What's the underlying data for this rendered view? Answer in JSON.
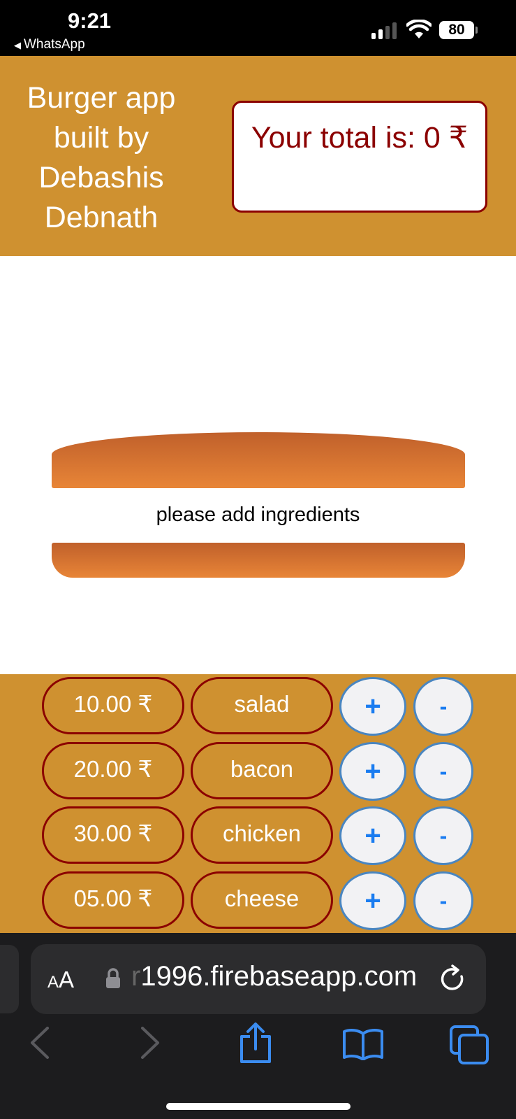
{
  "status_bar": {
    "time": "9:21",
    "back_app": "WhatsApp",
    "battery": "80"
  },
  "header": {
    "title": "Burger app built by Debashis Debnath",
    "total_label": "Your total is: 0 ₹"
  },
  "burger": {
    "empty_message": "please add ingredients"
  },
  "ingredients": [
    {
      "price": "10.00 ₹",
      "name": "salad",
      "add": "+",
      "remove": "-"
    },
    {
      "price": "20.00 ₹",
      "name": "bacon",
      "add": "+",
      "remove": "-"
    },
    {
      "price": "30.00 ₹",
      "name": "chicken",
      "add": "+",
      "remove": "-"
    },
    {
      "price": "05.00 ₹",
      "name": "cheese",
      "add": "+",
      "remove": "-"
    }
  ],
  "browser": {
    "text_size_label": "AA",
    "url_hidden_prefix": "r",
    "url": "1996.firebaseapp.com"
  },
  "colors": {
    "header_bg": "#cf9130",
    "accent_dark_red": "#8b0000",
    "bun": "#e88537",
    "button_blue": "#1a7cf0"
  },
  "icons": [
    "lock-icon",
    "reload-icon",
    "back-icon",
    "forward-icon",
    "share-icon",
    "bookmarks-icon",
    "tabs-icon"
  ]
}
